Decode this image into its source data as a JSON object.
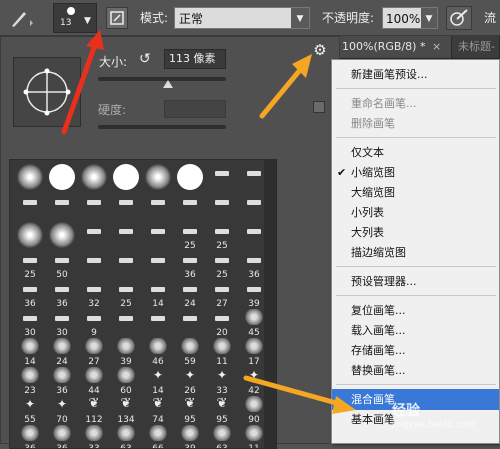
{
  "options_bar": {
    "brush_size": "13",
    "mode_label": "模式:",
    "mode_value": "正常",
    "opacity_label": "不透明度:",
    "opacity_value": "100%",
    "flow_label": "流"
  },
  "tabs": [
    {
      "label": "100%(RGB/8) *"
    },
    {
      "label": "未标题-"
    }
  ],
  "brush_picker": {
    "size_label": "大小:",
    "size_value": "113 像素",
    "size_fraction": 0.55,
    "hardness_label": "硬度:",
    "presets": [
      {
        "type": "soft-round",
        "n": ""
      },
      {
        "type": "hard-round",
        "n": ""
      },
      {
        "type": "soft-round",
        "n": ""
      },
      {
        "type": "hard-round",
        "n": ""
      },
      {
        "type": "soft-round",
        "n": ""
      },
      {
        "type": "hard-round",
        "n": ""
      },
      {
        "type": "tool",
        "n": ""
      },
      {
        "type": "tool",
        "n": ""
      },
      {
        "type": "tool",
        "n": ""
      },
      {
        "type": "tool",
        "n": ""
      },
      {
        "type": "tool",
        "n": ""
      },
      {
        "type": "tool",
        "n": ""
      },
      {
        "type": "tool",
        "n": ""
      },
      {
        "type": "tool",
        "n": ""
      },
      {
        "type": "tool",
        "n": ""
      },
      {
        "type": "tool",
        "n": ""
      },
      {
        "type": "soft-round",
        "n": ""
      },
      {
        "type": "soft-round",
        "n": ""
      },
      {
        "type": "tool",
        "n": ""
      },
      {
        "type": "tool",
        "n": ""
      },
      {
        "type": "tool",
        "n": ""
      },
      {
        "type": "tool",
        "n": "25"
      },
      {
        "type": "tool",
        "n": "25"
      },
      {
        "type": "tool",
        "n": ""
      },
      {
        "type": "tool",
        "n": "25"
      },
      {
        "type": "tool",
        "n": "50"
      },
      {
        "type": "tool",
        "n": ""
      },
      {
        "type": "tool",
        "n": ""
      },
      {
        "type": "tool",
        "n": ""
      },
      {
        "type": "tool",
        "n": "36"
      },
      {
        "type": "tool",
        "n": "25"
      },
      {
        "type": "tool",
        "n": "36"
      },
      {
        "type": "tool",
        "n": "36"
      },
      {
        "type": "tool",
        "n": "36"
      },
      {
        "type": "tool",
        "n": "32"
      },
      {
        "type": "tool",
        "n": "25"
      },
      {
        "type": "tool",
        "n": "14"
      },
      {
        "type": "tool",
        "n": "24"
      },
      {
        "type": "tool",
        "n": "27"
      },
      {
        "type": "tool",
        "n": "39"
      },
      {
        "type": "tool",
        "n": "30"
      },
      {
        "type": "tool",
        "n": "30"
      },
      {
        "type": "tool",
        "n": "9"
      },
      {
        "type": "tool",
        "n": ""
      },
      {
        "type": "tool",
        "n": ""
      },
      {
        "type": "tool",
        "n": ""
      },
      {
        "type": "tool",
        "n": "20"
      },
      {
        "type": "texture",
        "n": "45"
      },
      {
        "type": "texture",
        "n": "14"
      },
      {
        "type": "texture",
        "n": "24"
      },
      {
        "type": "texture",
        "n": "27"
      },
      {
        "type": "texture",
        "n": "39"
      },
      {
        "type": "texture",
        "n": "46"
      },
      {
        "type": "texture",
        "n": "59"
      },
      {
        "type": "texture",
        "n": "11"
      },
      {
        "type": "texture",
        "n": "17"
      },
      {
        "type": "texture",
        "n": "23"
      },
      {
        "type": "texture",
        "n": "36"
      },
      {
        "type": "texture",
        "n": "44"
      },
      {
        "type": "texture",
        "n": "60"
      },
      {
        "type": "star",
        "n": "14"
      },
      {
        "type": "star",
        "n": "26"
      },
      {
        "type": "star",
        "n": "33"
      },
      {
        "type": "star",
        "n": "42"
      },
      {
        "type": "star",
        "n": "55"
      },
      {
        "type": "star",
        "n": "70"
      },
      {
        "type": "leaf",
        "n": "112"
      },
      {
        "type": "leaf",
        "n": "134"
      },
      {
        "type": "leaf",
        "n": "74"
      },
      {
        "type": "leaf",
        "n": "95"
      },
      {
        "type": "leaf",
        "n": "95"
      },
      {
        "type": "texture",
        "n": "90"
      },
      {
        "type": "texture",
        "n": "36"
      },
      {
        "type": "texture",
        "n": "36"
      },
      {
        "type": "texture",
        "n": "33"
      },
      {
        "type": "texture",
        "n": "63"
      },
      {
        "type": "texture",
        "n": "66"
      },
      {
        "type": "texture",
        "n": "39"
      },
      {
        "type": "texture",
        "n": "63"
      },
      {
        "type": "texture",
        "n": "11"
      }
    ]
  },
  "menu": [
    {
      "label": "新建画笔预设...",
      "disabled": false,
      "checked": false,
      "highlighted": false
    },
    {
      "sep": true
    },
    {
      "label": "重命名画笔...",
      "disabled": true,
      "checked": false,
      "highlighted": false
    },
    {
      "label": "删除画笔",
      "disabled": true,
      "checked": false,
      "highlighted": false
    },
    {
      "sep": true
    },
    {
      "label": "仅文本",
      "disabled": false,
      "checked": false,
      "highlighted": false
    },
    {
      "label": "小缩览图",
      "disabled": false,
      "checked": true,
      "highlighted": false
    },
    {
      "label": "大缩览图",
      "disabled": false,
      "checked": false,
      "highlighted": false
    },
    {
      "label": "小列表",
      "disabled": false,
      "checked": false,
      "highlighted": false
    },
    {
      "label": "大列表",
      "disabled": false,
      "checked": false,
      "highlighted": false
    },
    {
      "label": "描边缩览图",
      "disabled": false,
      "checked": false,
      "highlighted": false
    },
    {
      "sep": true
    },
    {
      "label": "预设管理器...",
      "disabled": false,
      "checked": false,
      "highlighted": false
    },
    {
      "sep": true
    },
    {
      "label": "复位画笔...",
      "disabled": false,
      "checked": false,
      "highlighted": false
    },
    {
      "label": "载入画笔...",
      "disabled": false,
      "checked": false,
      "highlighted": false
    },
    {
      "label": "存储画笔...",
      "disabled": false,
      "checked": false,
      "highlighted": false
    },
    {
      "label": "替换画笔...",
      "disabled": false,
      "checked": false,
      "highlighted": false
    },
    {
      "sep": true
    },
    {
      "label": "混合画笔",
      "disabled": false,
      "checked": false,
      "highlighted": true
    },
    {
      "label": "基本画笔",
      "disabled": false,
      "checked": false,
      "highlighted": false
    }
  ],
  "watermark": {
    "text": "经验",
    "domain": "jingyan.baidu.com"
  },
  "colors": {
    "arrow": "#f5a623",
    "red_arrow": "#e8301c",
    "menu_highlight": "#3a78d8"
  }
}
